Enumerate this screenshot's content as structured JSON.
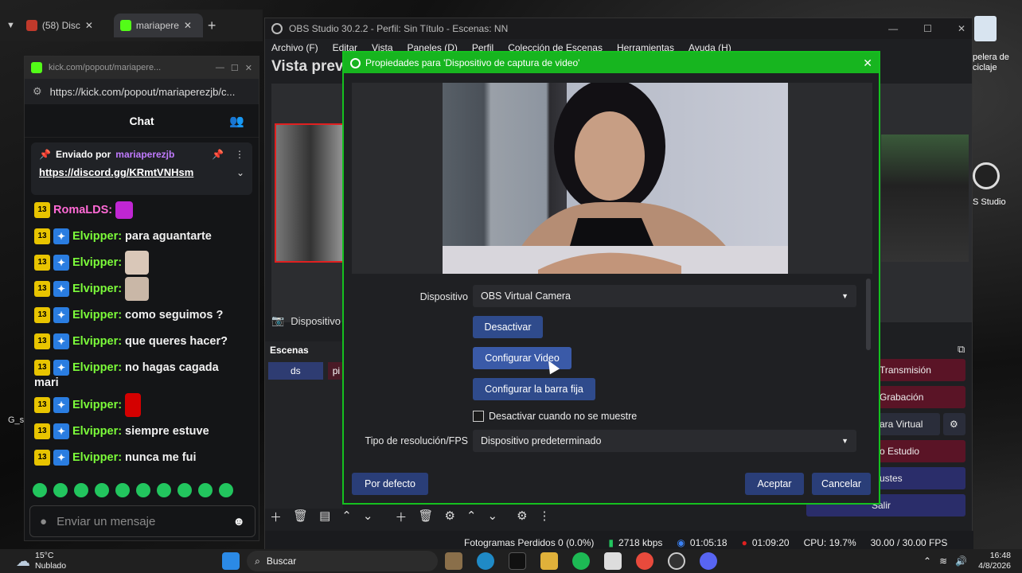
{
  "browser": {
    "tabs": [
      {
        "label": "(58) Disc"
      },
      {
        "label": "mariapere"
      }
    ],
    "popout_title": "kick.com/popout/mariapere...",
    "url": "https://kick.com/popout/mariaperezjb/c..."
  },
  "chat": {
    "header": "Chat",
    "pinned_prefix": "Enviado por",
    "pinned_user": "mariaperezjb",
    "pinned_link": "https://discord.gg/KRmtVNHsm",
    "messages": [
      {
        "badge": "13",
        "user": "RomaLDS:",
        "text": "",
        "emote": true
      },
      {
        "badge": "13",
        "user": "Elvipper:",
        "text": "para aguantarte"
      },
      {
        "badge": "13",
        "user": "Elvipper:",
        "text": "",
        "emote": true
      },
      {
        "badge": "13",
        "user": "Elvipper:",
        "text": "",
        "emote": true
      },
      {
        "badge": "13",
        "user": "Elvipper:",
        "text": "como seguimos ?"
      },
      {
        "badge": "13",
        "user": "Elvipper:",
        "text": "que queres hacer?"
      },
      {
        "badge": "13",
        "user": "Elvipper:",
        "text": "no hagas cagada",
        "cont": "mari"
      },
      {
        "badge": "13",
        "user": "Elvipper:",
        "text": "",
        "emote": true
      },
      {
        "badge": "13",
        "user": "Elvipper:",
        "text": "siempre estuve"
      },
      {
        "badge": "13",
        "user": "Elvipper:",
        "text": "nunca me fui"
      }
    ],
    "input_placeholder": "Enviar un mensaje"
  },
  "obs": {
    "title": "OBS Studio 30.2.2 - Perfil: Sin Título - Escenas: NN",
    "menu": [
      "Archivo (F)",
      "Editar",
      "Vista",
      "Paneles (D)",
      "Perfil",
      "Colección de Escenas",
      "Herramientas",
      "Ayuda (H)"
    ],
    "preview_title": "Vista prev",
    "source_label": "Dispositivo",
    "scenes_title": "Escenas",
    "scene_items": [
      "ds",
      "pi"
    ],
    "controls": [
      "Transmisión",
      "Grabación",
      "ara Virtual",
      "o Estudio",
      "ustes",
      "Salir"
    ],
    "status": {
      "dropped": "Fotogramas Perdidos 0 (0.0%)",
      "bitrate": "2718 kbps",
      "stream_time": "01:05:18",
      "rec_time": "01:09:20",
      "cpu": "CPU: 19.7%",
      "fps": "30.00 / 30.00 FPS"
    }
  },
  "dialog": {
    "title": "Propiedades para 'Dispositivo de captura de video'",
    "device_label": "Dispositivo",
    "device_value": "OBS Virtual Camera",
    "btn_deactivate": "Desactivar",
    "btn_config_video": "Configurar Video",
    "btn_config_bar": "Configurar la barra fija",
    "checkbox_label": "Desactivar cuando no se muestre",
    "resolution_label": "Tipo de resolución/FPS",
    "resolution_value": "Dispositivo predeterminado",
    "btn_default": "Por defecto",
    "btn_accept": "Aceptar",
    "btn_cancel": "Cancelar"
  },
  "desktop": {
    "recycle_label": "pelera de\nciclaje",
    "obs_label": "S Studio",
    "side_label": "G_s"
  },
  "taskbar": {
    "weather_temp": "15°C",
    "weather_desc": "Nublado",
    "search": "Buscar",
    "time": "16:48",
    "date": "4/8/2026"
  },
  "colors": {
    "kick_green": "#53fc18",
    "dialog_green": "#15c01f",
    "button_blue": "#2f4b8c",
    "control_red": "#5a1426"
  }
}
